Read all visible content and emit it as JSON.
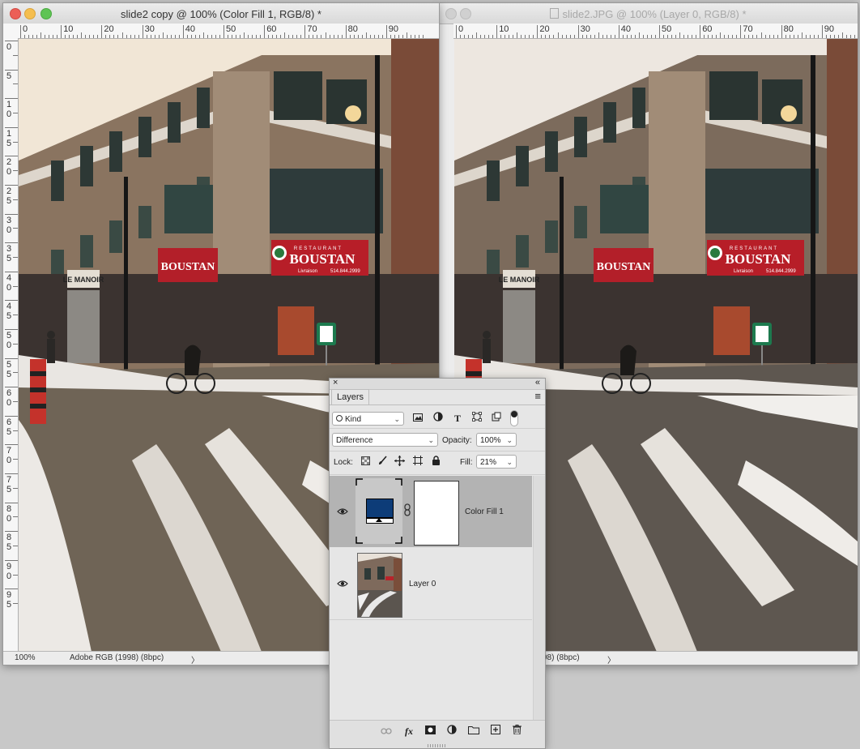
{
  "doc1": {
    "title": "slide2 copy @ 100% (Color Fill 1, RGB/8) *",
    "zoom": "100%",
    "profile": "Adobe RGB (1998) (8bpc)",
    "arrow": "〉"
  },
  "doc2": {
    "title": "slide2.JPG @ 100% (Layer 0, RGB/8) *",
    "profile_partial": "98) (8bpc)",
    "arrow": "〉"
  },
  "ruler": {
    "h_labels": [
      "0",
      "10",
      "20",
      "30",
      "40",
      "50",
      "60",
      "70",
      "80",
      "90"
    ],
    "v_labels": [
      [
        "0"
      ],
      [
        "5"
      ],
      [
        "1",
        "0"
      ],
      [
        "1",
        "5"
      ],
      [
        "2",
        "0"
      ],
      [
        "2",
        "5"
      ],
      [
        "3",
        "0"
      ],
      [
        "3",
        "5"
      ],
      [
        "4",
        "0"
      ],
      [
        "4",
        "5"
      ],
      [
        "5",
        "0"
      ],
      [
        "5",
        "5"
      ],
      [
        "6",
        "0"
      ],
      [
        "6",
        "5"
      ],
      [
        "7",
        "0"
      ],
      [
        "7",
        "5"
      ],
      [
        "8",
        "0"
      ],
      [
        "8",
        "5"
      ],
      [
        "9",
        "0"
      ],
      [
        "9",
        "5"
      ]
    ]
  },
  "signs": {
    "restaurant": "RESTAURANT",
    "brand": "BOUSTAN",
    "delivery": "Livraison",
    "phone": "514.844.2999",
    "manoir": "LE MANOIR"
  },
  "layers_panel": {
    "close": "×",
    "collapse": "«",
    "tab": "Layers",
    "menu": "≡",
    "filter_kind": "Kind",
    "blend_mode": "Difference",
    "opacity_label": "Opacity:",
    "opacity_value": "100%",
    "lock_label": "Lock:",
    "fill_label": "Fill:",
    "fill_value": "21%",
    "layers": [
      {
        "name": "Color Fill 1",
        "selected": true,
        "fill_color": "#0d3c78"
      },
      {
        "name": "Layer 0",
        "selected": false
      }
    ]
  },
  "colors": {
    "selection": "#b3b3b3",
    "fill_swatch": "#0d3c78"
  }
}
